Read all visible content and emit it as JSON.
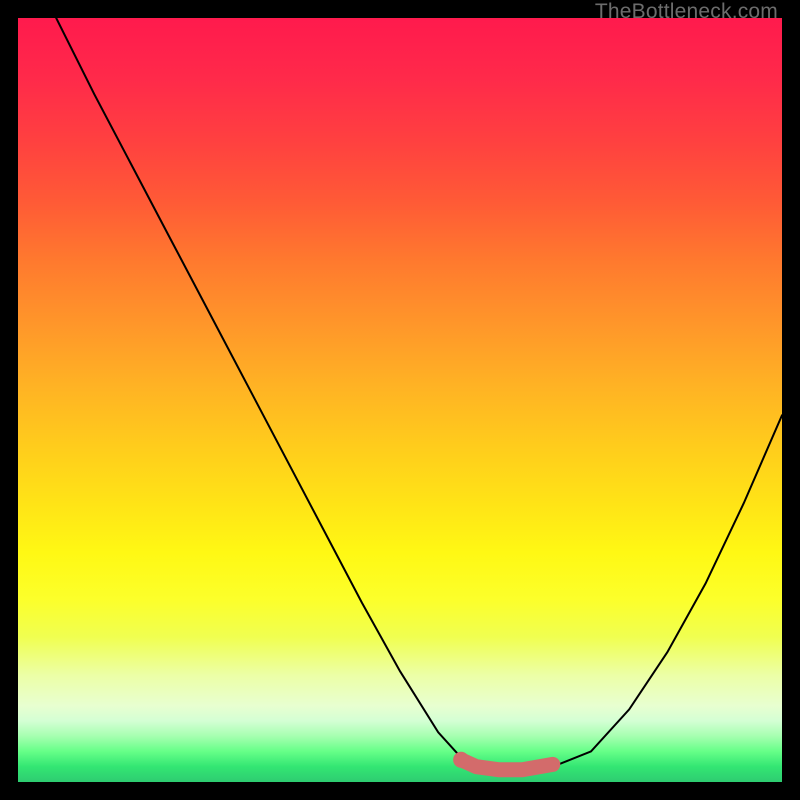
{
  "watermark": "TheBottleneck.com",
  "colors": {
    "curve": "#000000",
    "highlight": "#d36b6b",
    "gradient_top": "#ff1a4d",
    "gradient_bottom": "#2ecc71"
  },
  "chart_data": {
    "type": "line",
    "title": "",
    "xlabel": "",
    "ylabel": "",
    "xlim": [
      0,
      100
    ],
    "ylim": [
      0,
      100
    ],
    "series": [
      {
        "name": "bottleneck-curve",
        "x": [
          5,
          10,
          15,
          20,
          25,
          30,
          35,
          40,
          45,
          50,
          55,
          58,
          60,
          63,
          66,
          70,
          75,
          80,
          85,
          90,
          95,
          100
        ],
        "values": [
          100,
          90,
          80.5,
          71,
          61.5,
          52,
          42.5,
          33,
          23.5,
          14.5,
          6.5,
          3.2,
          2.2,
          1.6,
          1.6,
          2.0,
          4.0,
          9.5,
          17,
          26,
          36.5,
          48
        ]
      }
    ],
    "highlight": {
      "name": "optimal-range",
      "x": [
        58,
        60,
        63,
        66,
        70
      ],
      "values": [
        2.9,
        2.0,
        1.6,
        1.6,
        2.3
      ]
    }
  }
}
